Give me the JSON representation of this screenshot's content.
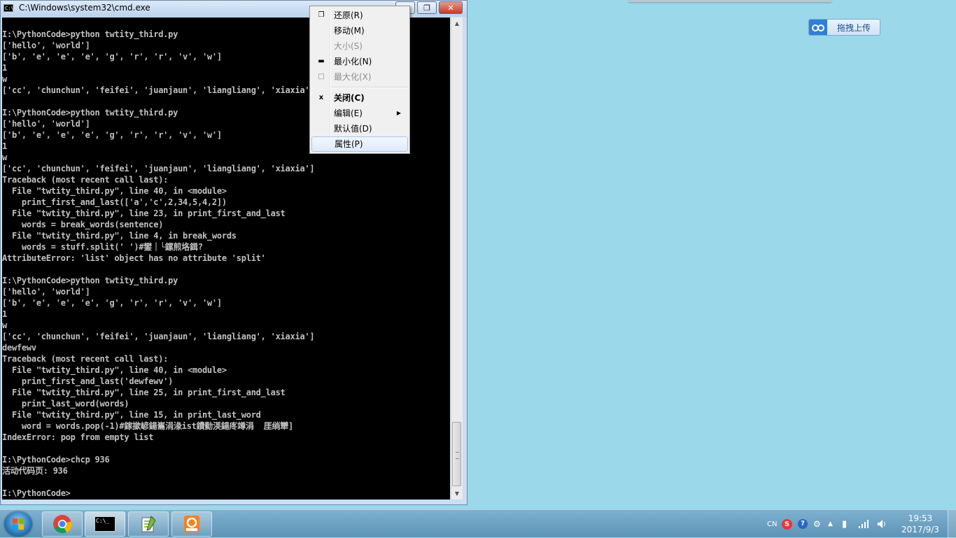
{
  "window": {
    "title": "C:\\Windows\\system32\\cmd.exe",
    "icon_text": "C:\\",
    "min_glyph": "—",
    "max_glyph": "❐",
    "close_glyph": "✕"
  },
  "console": {
    "lines": [
      "",
      "I:\\PythonCode>python twtity_third.py",
      "['hello', 'world']",
      "['b', 'e', 'e', 'e', 'g', 'r', 'r', 'v', 'w']",
      "1",
      "w",
      "['cc', 'chunchun', 'feifei', 'juanjaun', 'liangliang', 'xiaxia']",
      "",
      "I:\\PythonCode>python twtity_third.py",
      "['hello', 'world']",
      "['b', 'e', 'e', 'e', 'g', 'r', 'r', 'v', 'w']",
      "1",
      "w",
      "['cc', 'chunchun', 'feifei', 'juanjaun', 'liangliang', 'xiaxia']",
      "Traceback (most recent call last):",
      "  File \"twtity_third.py\", line 40, in <module>",
      "    print_first_and_last(['a','c',2,34,5,4,2])",
      "  File \"twtity_third.py\", line 23, in print_first_and_last",
      "    words = break_words(sentence)",
      "  File \"twtity_third.py\", line 4, in break_words",
      "    words = stuff.split(' ')#鐢｜└鏍煎垎鍓?",
      "AttributeError: 'list' object has no attribute 'split'",
      "",
      "I:\\PythonCode>python twtity_third.py",
      "['hello', 'world']",
      "['b', 'e', 'e', 'e', 'g', 'r', 'r', 'v', 'w']",
      "1",
      "w",
      "['cc', 'chunchun', 'feifei', 'juanjaun', 'liangliang', 'xiaxia']",
      "dewfewv",
      "Traceback (most recent call last):",
      "  File \"twtity_third.py\", line 40, in <module>",
      "    print_first_and_last('dewfewv')",
      "  File \"twtity_third.py\", line 25, in print_first_and_last",
      "    print_last_word(words)",
      "  File \"twtity_third.py\", line 15, in print_last_word",
      "    word = words.pop(-1)#鎵撳嵃鍚巂涓湪ist鐨勬渶鍚庝竴涓  厓绱犫]",
      "IndexError: pop from empty list",
      "",
      "I:\\PythonCode>chcp 936",
      "活动代码页: 936",
      "",
      "I:\\PythonCode>"
    ]
  },
  "scrollbar": {
    "up_glyph": "▲",
    "down_glyph": "▼"
  },
  "system_menu": {
    "restore": "还原(R)",
    "move": "移动(M)",
    "size": "大小(S)",
    "minimize": "最小化(N)",
    "maximize": "最大化(X)",
    "close": "关闭(C)",
    "edit": "编辑(E)",
    "defaults": "默认值(D)",
    "properties": "属性(P)",
    "restore_glyph": "❐",
    "minimize_glyph": "▬",
    "maximize_glyph": "□",
    "close_glyph": "x",
    "submenu_glyph": "▶"
  },
  "upload_button": {
    "label": "拖拽上传"
  },
  "taskbar": {
    "cmd_icon_text": "C:\\_",
    "tray": {
      "lang": "CN",
      "sogou": "S",
      "help": "?"
    },
    "clock": {
      "time": "19:53",
      "date": "2017/9/3"
    }
  }
}
